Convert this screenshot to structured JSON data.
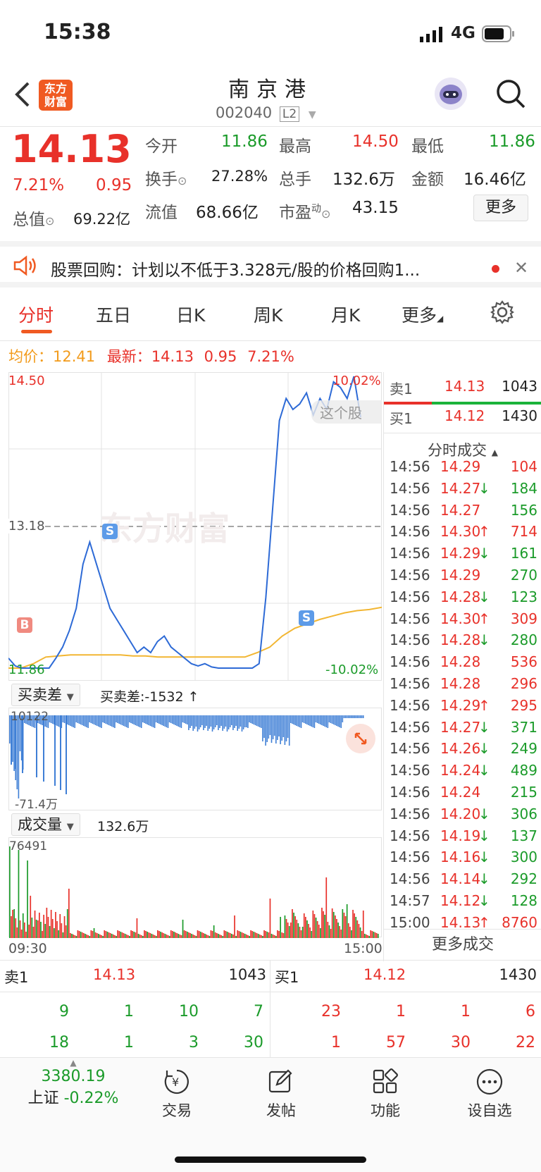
{
  "status": {
    "time": "15:38",
    "network": "4G"
  },
  "header": {
    "name": "南京港",
    "code": "002040",
    "level": "L2",
    "logo_line1": "东方",
    "logo_line2": "财富"
  },
  "quote": {
    "price": "14.13",
    "pct": "7.21%",
    "change": "0.95",
    "open_label": "今开",
    "open": "11.86",
    "high_label": "最高",
    "high": "14.50",
    "low_label": "最低",
    "low": "11.86",
    "turnover_label": "换手",
    "turnover": "27.28%",
    "vol_label": "总手",
    "vol": "132.6万",
    "amount_label": "金额",
    "amount": "16.46亿",
    "mktcap_label": "总值",
    "mktcap": "69.22亿",
    "float_label": "流值",
    "float": "68.66亿",
    "pe_label": "市盈",
    "pe_sup": "动",
    "pe": "43.15",
    "more": "更多"
  },
  "banner": {
    "text": "股票回购：计划以不低于3.328元/股的价格回购1..."
  },
  "tabs": [
    "分时",
    "五日",
    "日K",
    "周K",
    "月K",
    "更多"
  ],
  "avg_line": {
    "avg_label": "均价：",
    "avg": "12.41",
    "latest_label": "最新：",
    "latest": "14.13",
    "chg": "0.95",
    "pct": "7.21%"
  },
  "chart_data": {
    "type": "line",
    "y_max": "14.50",
    "y_mid": "13.18",
    "y_min": "11.86",
    "pct_top": "10.02%",
    "pct_bottom": "-10.02%",
    "x_start": "09:30",
    "x_end": "15:00",
    "buy_marker": "B",
    "sell_marker": "S",
    "watermark": "东方财富",
    "overlay_text": "这个股",
    "ylim": [
      11.86,
      14.5
    ],
    "series": [
      {
        "values": [
          11.95,
          11.88,
          11.86,
          11.86,
          11.86,
          11.86,
          11.86,
          11.95,
          12.05,
          12.2,
          12.4,
          12.8,
          13.0,
          12.8,
          12.6,
          12.4,
          12.3,
          12.2,
          12.1,
          12.0,
          12.05,
          12.0,
          12.1,
          12.15,
          12.05,
          12.0,
          11.95,
          11.9,
          11.88,
          11.9,
          11.87,
          11.86,
          11.86,
          11.86,
          11.86,
          11.86,
          11.86,
          11.9,
          12.5,
          13.3,
          14.1,
          14.3,
          14.2,
          14.25,
          14.35,
          14.15,
          14.3,
          14.2,
          14.45,
          14.4,
          14.3,
          14.5,
          14.13
        ]
      },
      {
        "values": [
          11.86,
          11.86,
          11.9,
          11.96,
          11.97,
          11.98,
          11.98,
          11.98,
          11.98,
          11.98,
          11.97,
          11.97,
          11.96,
          11.96,
          11.96,
          11.96,
          11.96,
          11.96,
          11.96,
          11.96,
          12.0,
          12.05,
          12.15,
          12.22,
          12.26,
          12.3,
          12.33,
          12.36,
          12.38,
          12.39,
          12.41
        ]
      }
    ]
  },
  "spread": {
    "label": "买卖差",
    "value_label": "买卖差:-1532",
    "top": "10122",
    "bottom": "-71.4万"
  },
  "volume": {
    "label": "成交量",
    "value": "132.6万",
    "top": "76491"
  },
  "book": {
    "sell_label": "卖1",
    "sell_price": "14.13",
    "sell_vol": "1043",
    "buy_label": "买1",
    "buy_price": "14.12",
    "buy_vol": "1430"
  },
  "ticks_title": "分时成交",
  "ticks": [
    {
      "t": "14:56",
      "p": "14.29",
      "a": "",
      "v": "104",
      "c": "r"
    },
    {
      "t": "14:56",
      "p": "14.27",
      "a": "↓",
      "v": "184",
      "c": "g"
    },
    {
      "t": "14:56",
      "p": "14.27",
      "a": "",
      "v": "156",
      "c": "g"
    },
    {
      "t": "14:56",
      "p": "14.30",
      "a": "↑",
      "v": "714",
      "c": "r"
    },
    {
      "t": "14:56",
      "p": "14.29",
      "a": "↓",
      "v": "161",
      "c": "g"
    },
    {
      "t": "14:56",
      "p": "14.29",
      "a": "",
      "v": "270",
      "c": "g"
    },
    {
      "t": "14:56",
      "p": "14.28",
      "a": "↓",
      "v": "123",
      "c": "g"
    },
    {
      "t": "14:56",
      "p": "14.30",
      "a": "↑",
      "v": "309",
      "c": "r"
    },
    {
      "t": "14:56",
      "p": "14.28",
      "a": "↓",
      "v": "280",
      "c": "g"
    },
    {
      "t": "14:56",
      "p": "14.28",
      "a": "",
      "v": "536",
      "c": "r"
    },
    {
      "t": "14:56",
      "p": "14.28",
      "a": "",
      "v": "296",
      "c": "r"
    },
    {
      "t": "14:56",
      "p": "14.29",
      "a": "↑",
      "v": "295",
      "c": "r"
    },
    {
      "t": "14:56",
      "p": "14.27",
      "a": "↓",
      "v": "371",
      "c": "g"
    },
    {
      "t": "14:56",
      "p": "14.26",
      "a": "↓",
      "v": "249",
      "c": "g"
    },
    {
      "t": "14:56",
      "p": "14.24",
      "a": "↓",
      "v": "489",
      "c": "g"
    },
    {
      "t": "14:56",
      "p": "14.24",
      "a": "",
      "v": "215",
      "c": "g"
    },
    {
      "t": "14:56",
      "p": "14.20",
      "a": "↓",
      "v": "306",
      "c": "g"
    },
    {
      "t": "14:56",
      "p": "14.19",
      "a": "↓",
      "v": "137",
      "c": "g"
    },
    {
      "t": "14:56",
      "p": "14.16",
      "a": "↓",
      "v": "300",
      "c": "g"
    },
    {
      "t": "14:56",
      "p": "14.14",
      "a": "↓",
      "v": "292",
      "c": "g"
    },
    {
      "t": "14:57",
      "p": "14.12",
      "a": "↓",
      "v": "128",
      "c": "g"
    },
    {
      "t": "15:00",
      "p": "14.13",
      "a": "↑",
      "v": "8760",
      "c": "r"
    }
  ],
  "more_ticks": "更多成交",
  "queue": {
    "sell_label": "卖1",
    "sell_price": "14.13",
    "sell_vol": "1043",
    "buy_label": "买1",
    "buy_price": "14.12",
    "buy_vol": "1430",
    "sell_row1": [
      "9",
      "1",
      "10",
      "7"
    ],
    "sell_row2": [
      "18",
      "1",
      "3",
      "30"
    ],
    "buy_row1": [
      "23",
      "1",
      "1",
      "6"
    ],
    "buy_row2": [
      "1",
      "57",
      "30",
      "22"
    ]
  },
  "bottom": {
    "index_value": "3380.19",
    "index_name": "上证",
    "index_pct": "-0.22%",
    "trade": "交易",
    "post": "发帖",
    "func": "功能",
    "watch": "设自选"
  }
}
